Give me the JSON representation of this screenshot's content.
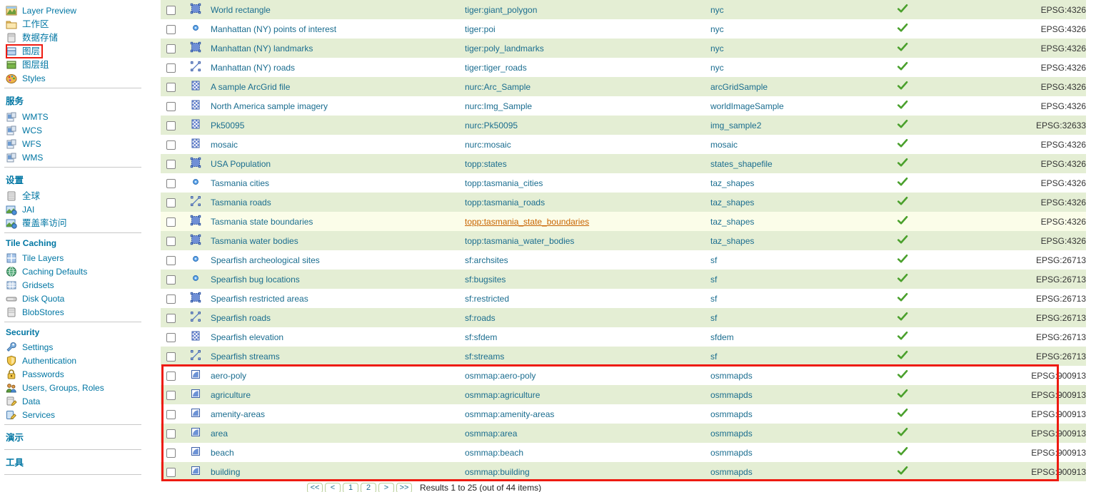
{
  "sidebar": {
    "groups": [
      {
        "title": "",
        "items": [
          {
            "label": "Layer Preview",
            "icon": "layer-preview-icon",
            "selected": false
          },
          {
            "label": "工作区",
            "icon": "workspace-folder-icon",
            "selected": false
          },
          {
            "label": "数据存储",
            "icon": "datastore-icon",
            "selected": false
          },
          {
            "label": "图层",
            "icon": "layers-icon",
            "selected": true
          },
          {
            "label": "图层组",
            "icon": "layergroup-icon",
            "selected": false
          },
          {
            "label": "Styles",
            "icon": "styles-palette-icon",
            "selected": false
          }
        ]
      },
      {
        "title": "服务",
        "items": [
          {
            "label": "WMTS",
            "icon": "service-icon",
            "selected": false
          },
          {
            "label": "WCS",
            "icon": "service-icon",
            "selected": false
          },
          {
            "label": "WFS",
            "icon": "service-icon",
            "selected": false
          },
          {
            "label": "WMS",
            "icon": "service-icon",
            "selected": false
          }
        ]
      },
      {
        "title": "设置",
        "items": [
          {
            "label": "全球",
            "icon": "global-settings-icon",
            "selected": false
          },
          {
            "label": "JAI",
            "icon": "jai-icon",
            "selected": false
          },
          {
            "label": "覆盖率访问",
            "icon": "coverage-access-icon",
            "selected": false
          }
        ]
      },
      {
        "title": "Tile Caching",
        "items": [
          {
            "label": "Tile Layers",
            "icon": "tile-layers-icon",
            "selected": false
          },
          {
            "label": "Caching Defaults",
            "icon": "caching-defaults-globe-icon",
            "selected": false
          },
          {
            "label": "Gridsets",
            "icon": "gridsets-icon",
            "selected": false
          },
          {
            "label": "Disk Quota",
            "icon": "disk-quota-icon",
            "selected": false
          },
          {
            "label": "BlobStores",
            "icon": "blobstores-icon",
            "selected": false
          }
        ]
      },
      {
        "title": "Security",
        "items": [
          {
            "label": "Settings",
            "icon": "wrench-icon",
            "selected": false
          },
          {
            "label": "Authentication",
            "icon": "shield-icon",
            "selected": false
          },
          {
            "label": "Passwords",
            "icon": "lock-icon",
            "selected": false
          },
          {
            "label": "Users, Groups, Roles",
            "icon": "users-icon",
            "selected": false
          },
          {
            "label": "Data",
            "icon": "data-security-icon",
            "selected": false
          },
          {
            "label": "Services",
            "icon": "services-security-icon",
            "selected": false
          }
        ]
      },
      {
        "title": "演示",
        "items": []
      },
      {
        "title": "工具",
        "items": []
      }
    ]
  },
  "colors": {
    "accent_link": "#1a6d8f",
    "group_title": "#0076a3",
    "row_odd": "#e4eed4",
    "row_even": "#ffffff",
    "row_hover": "#fbfde9",
    "highlight_border": "#ee1b11",
    "check_green": "#4aa02c",
    "hovered_link": "#c86400"
  },
  "table": {
    "enabled_mark": "✔",
    "rows": [
      {
        "title": "World rectangle",
        "name": "tiger:giant_polygon",
        "store": "nyc",
        "enabled": true,
        "srs": "EPSG:4326",
        "icon": "polygon-icon",
        "highlighted": false,
        "hovered_name": false
      },
      {
        "title": "Manhattan (NY) points of interest",
        "name": "tiger:poi",
        "store": "nyc",
        "enabled": true,
        "srs": "EPSG:4326",
        "icon": "point-icon",
        "highlighted": false,
        "hovered_name": false
      },
      {
        "title": "Manhattan (NY) landmarks",
        "name": "tiger:poly_landmarks",
        "store": "nyc",
        "enabled": true,
        "srs": "EPSG:4326",
        "icon": "polygon-icon",
        "highlighted": false,
        "hovered_name": false
      },
      {
        "title": "Manhattan (NY) roads",
        "name": "tiger:tiger_roads",
        "store": "nyc",
        "enabled": true,
        "srs": "EPSG:4326",
        "icon": "line-icon",
        "highlighted": false,
        "hovered_name": false
      },
      {
        "title": "A sample ArcGrid file",
        "name": "nurc:Arc_Sample",
        "store": "arcGridSample",
        "enabled": true,
        "srs": "EPSG:4326",
        "icon": "raster-icon",
        "highlighted": false,
        "hovered_name": false
      },
      {
        "title": "North America sample imagery",
        "name": "nurc:Img_Sample",
        "store": "worldImageSample",
        "enabled": true,
        "srs": "EPSG:4326",
        "icon": "raster-icon",
        "highlighted": false,
        "hovered_name": false
      },
      {
        "title": "Pk50095",
        "name": "nurc:Pk50095",
        "store": "img_sample2",
        "enabled": true,
        "srs": "EPSG:32633",
        "icon": "raster-icon",
        "highlighted": false,
        "hovered_name": false
      },
      {
        "title": "mosaic",
        "name": "nurc:mosaic",
        "store": "mosaic",
        "enabled": true,
        "srs": "EPSG:4326",
        "icon": "raster-icon",
        "highlighted": false,
        "hovered_name": false
      },
      {
        "title": "USA Population",
        "name": "topp:states",
        "store": "states_shapefile",
        "enabled": true,
        "srs": "EPSG:4326",
        "icon": "polygon-icon",
        "highlighted": false,
        "hovered_name": false
      },
      {
        "title": "Tasmania cities",
        "name": "topp:tasmania_cities",
        "store": "taz_shapes",
        "enabled": true,
        "srs": "EPSG:4326",
        "icon": "point-icon",
        "highlighted": false,
        "hovered_name": false
      },
      {
        "title": "Tasmania roads",
        "name": "topp:tasmania_roads",
        "store": "taz_shapes",
        "enabled": true,
        "srs": "EPSG:4326",
        "icon": "line-icon",
        "highlighted": false,
        "hovered_name": false
      },
      {
        "title": "Tasmania state boundaries",
        "name": "topp:tasmania_state_boundaries",
        "store": "taz_shapes",
        "enabled": true,
        "srs": "EPSG:4326",
        "icon": "polygon-icon",
        "highlighted": false,
        "hovered_name": true
      },
      {
        "title": "Tasmania water bodies",
        "name": "topp:tasmania_water_bodies",
        "store": "taz_shapes",
        "enabled": true,
        "srs": "EPSG:4326",
        "icon": "polygon-icon",
        "highlighted": false,
        "hovered_name": false
      },
      {
        "title": "Spearfish archeological sites",
        "name": "sf:archsites",
        "store": "sf",
        "enabled": true,
        "srs": "EPSG:26713",
        "icon": "point-icon",
        "highlighted": false,
        "hovered_name": false
      },
      {
        "title": "Spearfish bug locations",
        "name": "sf:bugsites",
        "store": "sf",
        "enabled": true,
        "srs": "EPSG:26713",
        "icon": "point-icon",
        "highlighted": false,
        "hovered_name": false
      },
      {
        "title": "Spearfish restricted areas",
        "name": "sf:restricted",
        "store": "sf",
        "enabled": true,
        "srs": "EPSG:26713",
        "icon": "polygon-icon",
        "highlighted": false,
        "hovered_name": false
      },
      {
        "title": "Spearfish roads",
        "name": "sf:roads",
        "store": "sf",
        "enabled": true,
        "srs": "EPSG:26713",
        "icon": "line-icon",
        "highlighted": false,
        "hovered_name": false
      },
      {
        "title": "Spearfish elevation",
        "name": "sf:sfdem",
        "store": "sfdem",
        "enabled": true,
        "srs": "EPSG:26713",
        "icon": "raster-icon",
        "highlighted": false,
        "hovered_name": false
      },
      {
        "title": "Spearfish streams",
        "name": "sf:streams",
        "store": "sf",
        "enabled": true,
        "srs": "EPSG:26713",
        "icon": "line-icon",
        "highlighted": false,
        "hovered_name": false
      },
      {
        "title": "aero-poly",
        "name": "osmmap:aero-poly",
        "store": "osmmapds",
        "enabled": true,
        "srs": "EPSG:900913",
        "icon": "wms-layer-icon",
        "highlighted": true,
        "hovered_name": false
      },
      {
        "title": "agriculture",
        "name": "osmmap:agriculture",
        "store": "osmmapds",
        "enabled": true,
        "srs": "EPSG:900913",
        "icon": "wms-layer-icon",
        "highlighted": true,
        "hovered_name": false
      },
      {
        "title": "amenity-areas",
        "name": "osmmap:amenity-areas",
        "store": "osmmapds",
        "enabled": true,
        "srs": "EPSG:900913",
        "icon": "wms-layer-icon",
        "highlighted": true,
        "hovered_name": false
      },
      {
        "title": "area",
        "name": "osmmap:area",
        "store": "osmmapds",
        "enabled": true,
        "srs": "EPSG:900913",
        "icon": "wms-layer-icon",
        "highlighted": true,
        "hovered_name": false
      },
      {
        "title": "beach",
        "name": "osmmap:beach",
        "store": "osmmapds",
        "enabled": true,
        "srs": "EPSG:900913",
        "icon": "wms-layer-icon",
        "highlighted": true,
        "hovered_name": false
      },
      {
        "title": "building",
        "name": "osmmap:building",
        "store": "osmmapds",
        "enabled": true,
        "srs": "EPSG:900913",
        "icon": "wms-layer-icon",
        "highlighted": true,
        "hovered_name": false
      }
    ]
  },
  "pagination": {
    "buttons": [
      "<<",
      "<",
      "1",
      "2",
      ">",
      ">>"
    ],
    "status": "Results 1 to 25 (out of 44 items)"
  }
}
